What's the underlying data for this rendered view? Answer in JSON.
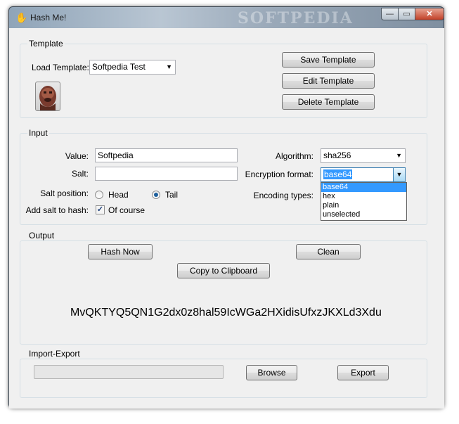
{
  "window": {
    "title": "Hash Me!",
    "watermark": "SOFTPEDIA",
    "min_label": "—",
    "max_label": "▭",
    "close_label": "✕"
  },
  "template": {
    "group_title": "Template",
    "load_label": "Load Template:",
    "load_value": "Softpedia Test",
    "save_button": "Save Template",
    "edit_button": "Edit Template",
    "delete_button": "Delete Template",
    "avatar_icon": "chewbacca-avatar-icon"
  },
  "input": {
    "group_title": "Input",
    "value_label": "Value:",
    "value": "Softpedia",
    "salt_label": "Salt:",
    "salt_value": "",
    "salt_position_label": "Salt position:",
    "head_label": "Head",
    "tail_label": "Tail",
    "salt_position_selected": "Tail",
    "add_salt_label": "Add salt to hash:",
    "add_salt_checked": true,
    "of_course_label": "Of course",
    "algorithm_label": "Algorithm:",
    "algorithm_value": "sha256",
    "encryption_label": "Encryption format:",
    "encryption_value": "base64",
    "encoding_label": "Encoding types:",
    "encryption_options": [
      "base64",
      "hex",
      "plain",
      "unselected"
    ]
  },
  "output": {
    "group_title": "Output",
    "hash_now_button": "Hash Now",
    "clean_button": "Clean",
    "copy_button": "Copy to Clipboard",
    "hash_result": "MvQKTYQ5QN1G2dx0z8hal59IcWGa2HXidisUfxzJKXLd3Xdu"
  },
  "import_export": {
    "group_title": "Import-Export",
    "browse_button": "Browse",
    "export_button": "Export",
    "path_value": ""
  },
  "colors": {
    "accent": "#3399ff",
    "close_button": "#c24128",
    "form_bg": "#f0f0f0"
  }
}
